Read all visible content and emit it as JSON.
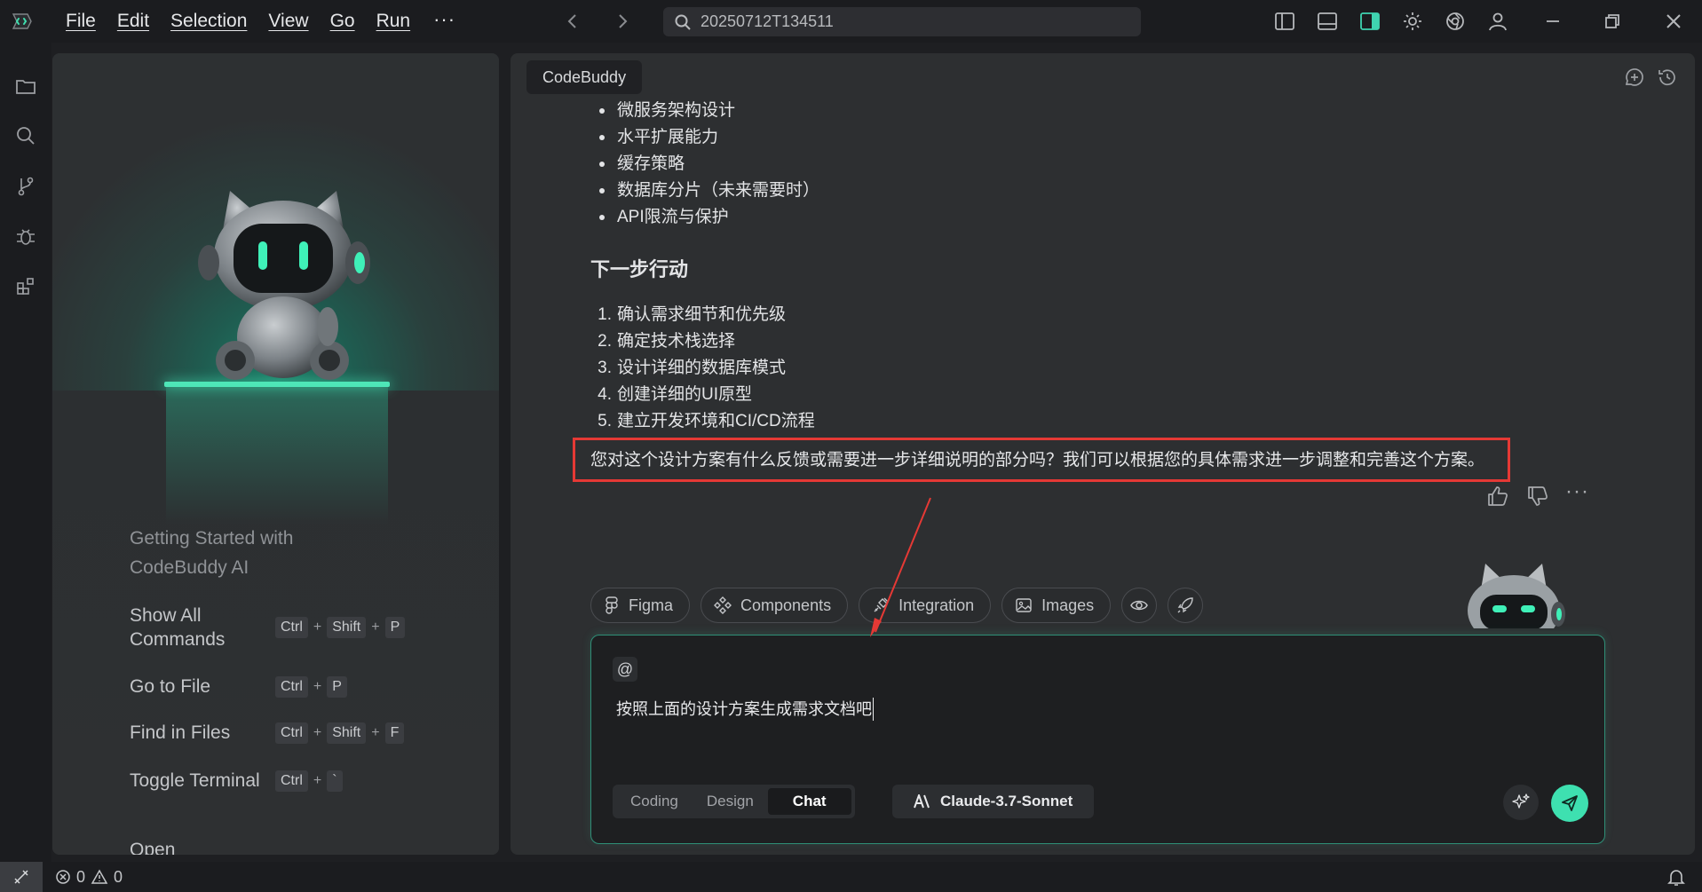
{
  "titlebar": {
    "menu": [
      "File",
      "Edit",
      "Selection",
      "View",
      "Go",
      "Run"
    ],
    "more": "···",
    "search_text": "20250712T134511"
  },
  "welcome": {
    "title": "Getting Started with CodeBuddy AI",
    "shortcuts": [
      {
        "label": "Show All Commands",
        "keys": [
          "Ctrl",
          "Shift",
          "P"
        ]
      },
      {
        "label": "Go to File",
        "keys": [
          "Ctrl",
          "P"
        ]
      },
      {
        "label": "Find in Files",
        "keys": [
          "Ctrl",
          "Shift",
          "F"
        ]
      },
      {
        "label": "Toggle Terminal",
        "keys": [
          "Ctrl",
          "`"
        ]
      },
      {
        "label": "Open",
        "keys": []
      }
    ]
  },
  "chat": {
    "tab_label": "CodeBuddy",
    "bullets": [
      "微服务架构设计",
      "水平扩展能力",
      "缓存策略",
      "数据库分片（未来需要时）",
      "API限流与保护"
    ],
    "next_heading": "下一步行动",
    "steps": [
      "确认需求细节和优先级",
      "确定技术栈选择",
      "设计详细的数据库模式",
      "创建详细的UI原型",
      "建立开发环境和CI/CD流程"
    ],
    "closing": "您对这个设计方案有什么反馈或需要进一步详细说明的部分吗？我们可以根据您的具体需求进一步调整和完善这个方案。",
    "more": "···",
    "chips": [
      "Figma",
      "Components",
      "Integration",
      "Images"
    ],
    "input": {
      "at": "@",
      "value": "按照上面的设计方案生成需求文档吧"
    },
    "modes": [
      "Coding",
      "Design",
      "Chat"
    ],
    "active_mode": "Chat",
    "model": "Claude-3.7-Sonnet"
  },
  "statusbar": {
    "errors": "0",
    "warnings": "0"
  },
  "colors": {
    "accent": "#3ee0b0",
    "highlight_border": "#e53935",
    "panel_bg": "#2d2f31"
  }
}
